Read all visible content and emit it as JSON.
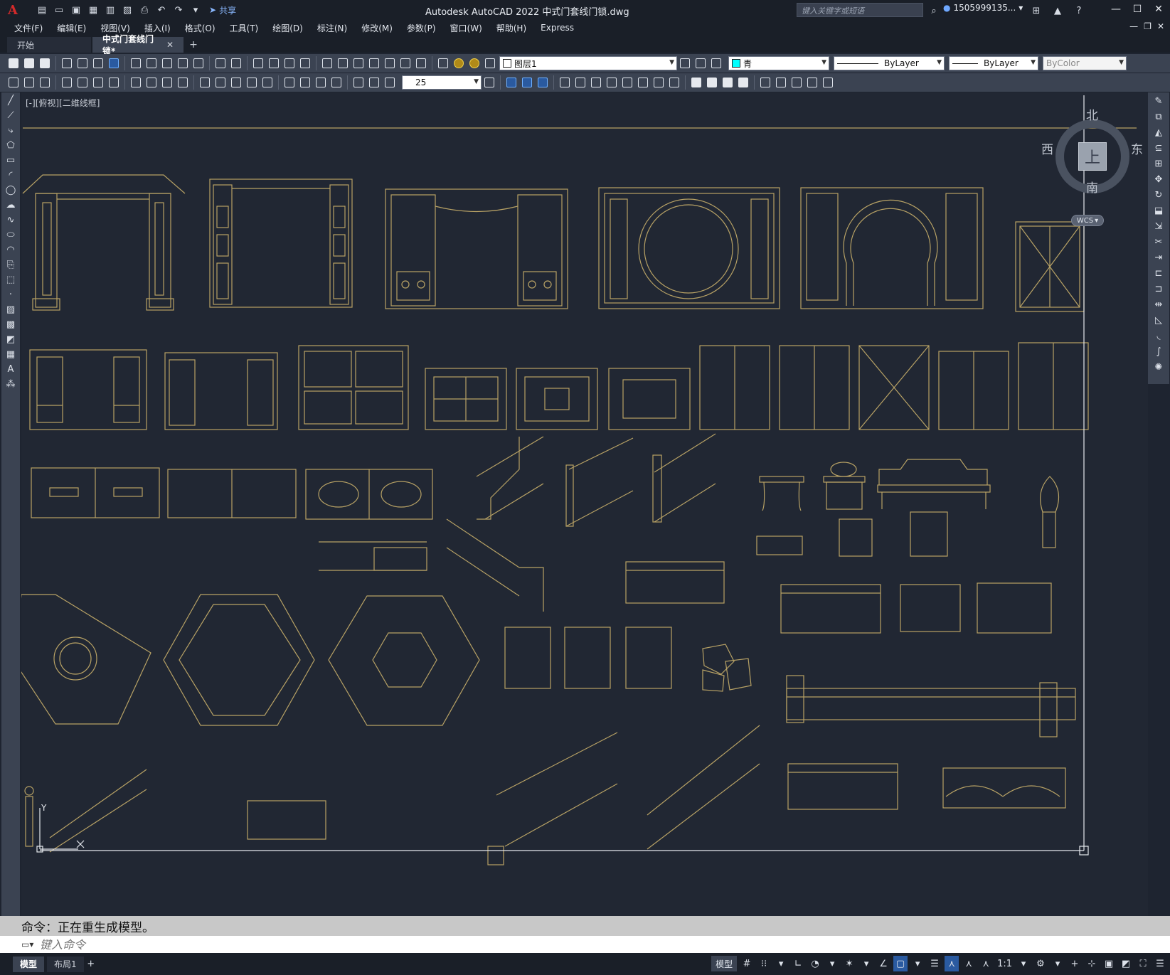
{
  "titlebar": {
    "app_logo": "A",
    "share_label": "共享",
    "title": "Autodesk AutoCAD 2022    中式门套线门锁.dwg",
    "search_placeholder": "键入关键字或短语",
    "username": "1505999135...",
    "icons": [
      "new-icon",
      "open-icon",
      "save-icon",
      "saveas-icon",
      "print-icon",
      "undo-icon",
      "redo-icon"
    ]
  },
  "menu": {
    "items": [
      "文件(F)",
      "编辑(E)",
      "视图(V)",
      "插入(I)",
      "格式(O)",
      "工具(T)",
      "绘图(D)",
      "标注(N)",
      "修改(M)",
      "参数(P)",
      "窗口(W)",
      "帮助(H)",
      "Express"
    ]
  },
  "tabs": {
    "items": [
      {
        "label": "开始",
        "active": false
      },
      {
        "label": "中式门套线门锁*",
        "active": true
      }
    ]
  },
  "toolbar1": {
    "layer_value": "图层1",
    "color_value": "青",
    "color_hex": "#00ffff",
    "linetype_value": "ByLayer",
    "lineweight_value": "ByLayer",
    "plotstyle_value": "ByColor"
  },
  "toolbar2": {
    "dimstyle_value": "25"
  },
  "viewport": {
    "view_label": "[-][俯视][二维线框]",
    "north": "北",
    "south": "南",
    "east": "东",
    "west": "西",
    "cube_face": "上",
    "wcs": "WCS",
    "drawing_color": "#b8a265",
    "ucs_y": "Y"
  },
  "command": {
    "history": "命令：正在重生成模型。",
    "placeholder": "键入命令"
  },
  "statusbar": {
    "layout_tabs": [
      {
        "label": "模型",
        "active": true
      },
      {
        "label": "布局1",
        "active": false
      }
    ],
    "model_label": "模型",
    "scale": "1:1"
  }
}
